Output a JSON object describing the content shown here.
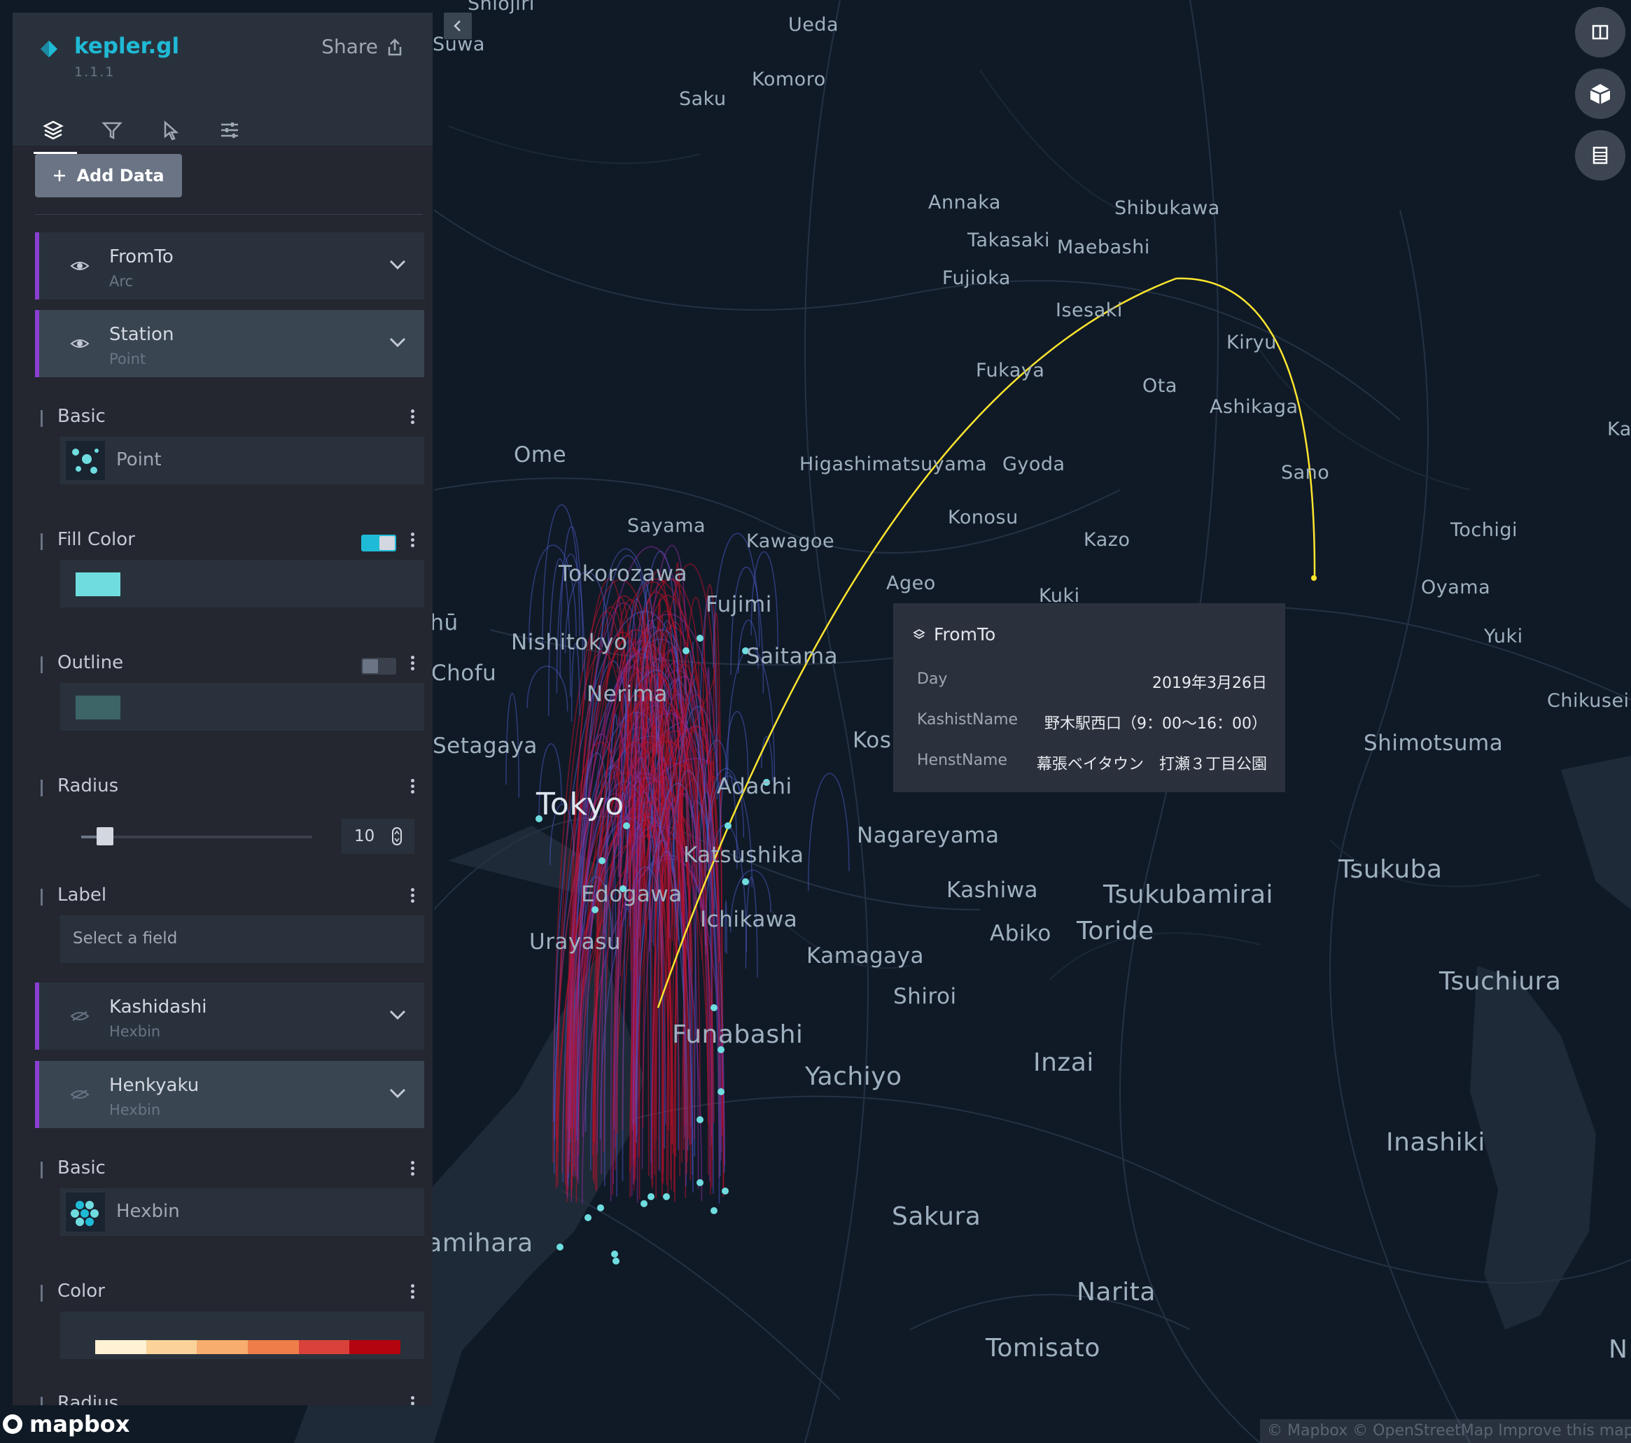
{
  "app": {
    "title": "kepler.gl",
    "version": "1.1.1",
    "share_label": "Share"
  },
  "tabs": [
    {
      "name": "layers",
      "icon": "layers-icon",
      "active": true
    },
    {
      "name": "filters",
      "icon": "filter-icon",
      "active": false
    },
    {
      "name": "interactions",
      "icon": "cursor-icon",
      "active": false
    },
    {
      "name": "map-style",
      "icon": "sliders-icon",
      "active": false
    }
  ],
  "add_data_label": "Add Data",
  "layers": [
    {
      "name": "FromTo",
      "type": "Arc"
    },
    {
      "name": "Station",
      "type": "Point"
    },
    {
      "name": "Kashidashi",
      "type": "Hexbin"
    },
    {
      "name": "Henkyaku",
      "type": "Hexbin"
    }
  ],
  "station_config": {
    "basic_label": "Basic",
    "basic_value": "Point",
    "fill_label": "Fill Color",
    "fill_color": "#6fdde0",
    "outline_label": "Outline",
    "outline_color": "#3d6467",
    "radius_label": "Radius",
    "radius_value": "10",
    "label_label": "Label",
    "label_placeholder": "Select a field"
  },
  "henkyaku_config": {
    "basic_label": "Basic",
    "basic_value": "Hexbin",
    "color_label": "Color",
    "radius_label": "Radius",
    "palette": [
      "#fff2d4",
      "#fbd39a",
      "#f6ad6e",
      "#ee7d4a",
      "#d8423a",
      "#b4040f"
    ]
  },
  "tooltip": {
    "layer": "FromTo",
    "rows": [
      {
        "key": "Day",
        "value": "2019年3月26日"
      },
      {
        "key": "KashistName",
        "value": "野木駅西口（9：00〜16：00）"
      },
      {
        "key": "HenstName",
        "value": "幕張ベイタウン　打瀬３丁目公園"
      }
    ]
  },
  "map_buttons": [
    "split-map-icon",
    "3d-view-icon",
    "legend-icon"
  ],
  "cities": [
    {
      "name": "Shiojiri",
      "size": "s"
    },
    {
      "name": "Suwa",
      "size": "s"
    },
    {
      "name": "Ueda",
      "size": "s"
    },
    {
      "name": "Komoro",
      "size": "s"
    },
    {
      "name": "Saku",
      "size": "s"
    },
    {
      "name": "Annaka",
      "size": "s"
    },
    {
      "name": "Shibukawa",
      "size": "s"
    },
    {
      "name": "Takasaki",
      "size": "s"
    },
    {
      "name": "Maebashi",
      "size": "s"
    },
    {
      "name": "Fujioka",
      "size": "s"
    },
    {
      "name": "Isesaki",
      "size": "s"
    },
    {
      "name": "Kiryu",
      "size": "s"
    },
    {
      "name": "Fukaya",
      "size": "s"
    },
    {
      "name": "Ota",
      "size": "s"
    },
    {
      "name": "Ashikaga",
      "size": "s"
    },
    {
      "name": "Kanu",
      "size": "s"
    },
    {
      "name": "Ome",
      "size": "m"
    },
    {
      "name": "Higashimatsuyama",
      "size": "s"
    },
    {
      "name": "Gyoda",
      "size": "s"
    },
    {
      "name": "Sano",
      "size": "s"
    },
    {
      "name": "Sayama",
      "size": "s"
    },
    {
      "name": "Konosu",
      "size": "s"
    },
    {
      "name": "Kawagoe",
      "size": "s"
    },
    {
      "name": "Kazo",
      "size": "s"
    },
    {
      "name": "Tochigi",
      "size": "s"
    },
    {
      "name": "Tokorozawa",
      "size": "m"
    },
    {
      "name": "Ageo",
      "size": "s"
    },
    {
      "name": "Oyama",
      "size": "s"
    },
    {
      "name": "Fujimi",
      "size": "m"
    },
    {
      "name": "Kuki",
      "size": "s"
    },
    {
      "name": "Yuki",
      "size": "s"
    },
    {
      "name": "Fuchū",
      "size": "m"
    },
    {
      "name": "Nishitokyo",
      "size": "m"
    },
    {
      "name": "Saitama",
      "size": "m"
    },
    {
      "name": "Chofu",
      "size": "m"
    },
    {
      "name": "Nerima",
      "size": "m"
    },
    {
      "name": "Chikusei",
      "size": "s"
    },
    {
      "name": "Setagaya",
      "size": "m"
    },
    {
      "name": "Koshigaya",
      "size": "m"
    },
    {
      "name": "Shimotsuma",
      "size": "m"
    },
    {
      "name": "Adachi",
      "size": "m"
    },
    {
      "name": "Tokyo",
      "size": "xl"
    },
    {
      "name": "Nagareyama",
      "size": "m"
    },
    {
      "name": "Katsushika",
      "size": "m"
    },
    {
      "name": "Tsukuba",
      "size": "l"
    },
    {
      "name": "Kashiwa",
      "size": "m"
    },
    {
      "name": "Tsukubamirai",
      "size": "l"
    },
    {
      "name": "Edogawa",
      "size": "m"
    },
    {
      "name": "Ichikawa",
      "size": "m"
    },
    {
      "name": "Abiko",
      "size": "m"
    },
    {
      "name": "Toride",
      "size": "l"
    },
    {
      "name": "Urayasu",
      "size": "m"
    },
    {
      "name": "Kamagaya",
      "size": "m"
    },
    {
      "name": "Tsuchiura",
      "size": "l"
    },
    {
      "name": "Shiroi",
      "size": "m"
    },
    {
      "name": "Funabashi",
      "size": "l"
    },
    {
      "name": "Inzai",
      "size": "l"
    },
    {
      "name": "Yachiyo",
      "size": "l"
    },
    {
      "name": "Inashiki",
      "size": "l"
    },
    {
      "name": "Sagamihara",
      "size": "l"
    },
    {
      "name": "Sakura",
      "size": "l"
    },
    {
      "name": "Narita",
      "size": "l"
    },
    {
      "name": "Tomisato",
      "size": "l"
    },
    {
      "name": "N",
      "size": "l"
    }
  ],
  "footer": {
    "mapbox_label": "mapbox",
    "attribution": "© Mapbox © OpenStreetMap Improve this map"
  }
}
